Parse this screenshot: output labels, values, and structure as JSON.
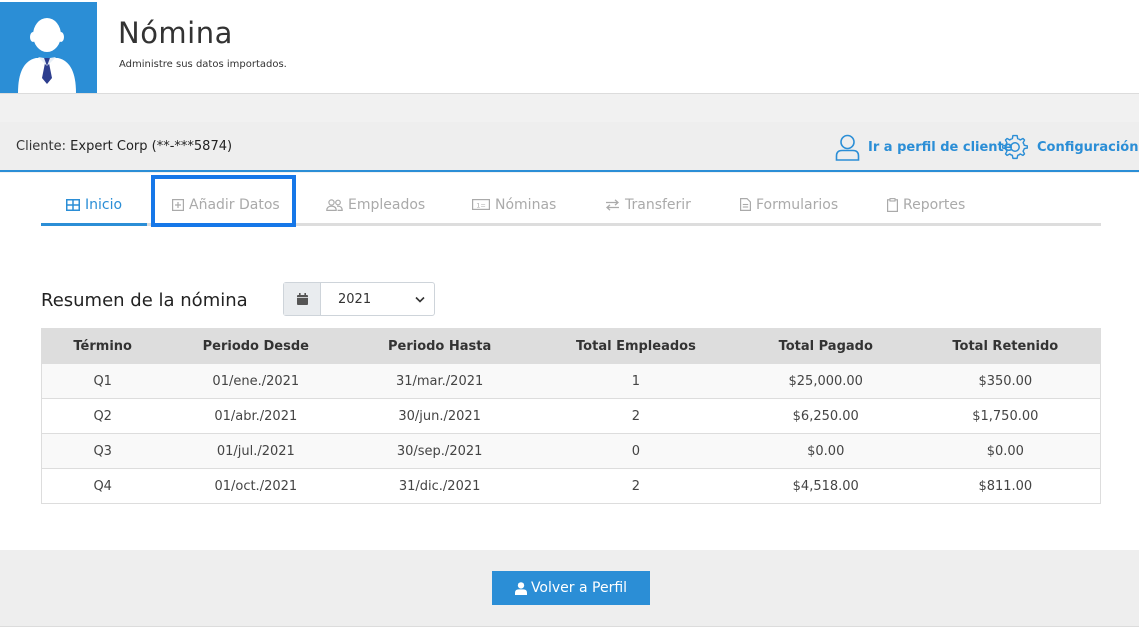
{
  "header": {
    "title": "Nómina",
    "subtitle": "Administre sus datos importados."
  },
  "client_bar": {
    "label": "Cliente:",
    "name": "Expert Corp (**-***5874)",
    "profile_link": "Ir a perfil de cliente",
    "config_link": "Configuración"
  },
  "tabs": [
    {
      "label": "Inicio",
      "icon": "table-icon",
      "active": true
    },
    {
      "label": "Añadir Datos",
      "icon": "plus-square-icon",
      "active": false
    },
    {
      "label": "Empleados",
      "icon": "users-icon",
      "active": false
    },
    {
      "label": "Nóminas",
      "icon": "money-bill-icon",
      "active": false
    },
    {
      "label": "Transferir",
      "icon": "exchange-icon",
      "active": false
    },
    {
      "label": "Formularios",
      "icon": "file-icon",
      "active": false
    },
    {
      "label": "Reportes",
      "icon": "clipboard-icon",
      "active": false
    }
  ],
  "summary": {
    "title": "Resumen de la nómina",
    "year": "2021",
    "columns": [
      "Término",
      "Periodo Desde",
      "Periodo Hasta",
      "Total Empleados",
      "Total Pagado",
      "Total Retenido"
    ],
    "rows": [
      [
        "Q1",
        "01/ene./2021",
        "31/mar./2021",
        "1",
        "$25,000.00",
        "$350.00"
      ],
      [
        "Q2",
        "01/abr./2021",
        "30/jun./2021",
        "2",
        "$6,250.00",
        "$1,750.00"
      ],
      [
        "Q3",
        "01/jul./2021",
        "30/sep./2021",
        "0",
        "$0.00",
        "$0.00"
      ],
      [
        "Q4",
        "01/oct./2021",
        "31/dic./2021",
        "2",
        "$4,518.00",
        "$811.00"
      ]
    ]
  },
  "footer": {
    "back_button": "Volver a Perfil"
  },
  "colors": {
    "accent": "#2b8ed6",
    "highlight": "#1677e8"
  }
}
